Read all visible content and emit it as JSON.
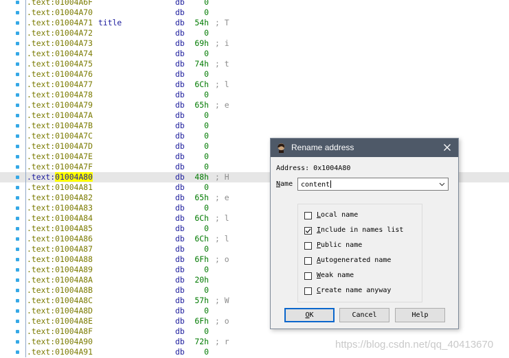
{
  "listing": {
    "rows": [
      {
        "seg": ".text:",
        "addr": "01004A6F",
        "label": "",
        "mnem": "db",
        "op": "0",
        "cmt": ""
      },
      {
        "seg": ".text:",
        "addr": "01004A70",
        "label": "",
        "mnem": "db",
        "op": "0",
        "cmt": ""
      },
      {
        "seg": ".text:",
        "addr": "01004A71",
        "label": "title",
        "mnem": "db",
        "op": "54h",
        "cmt": "; T"
      },
      {
        "seg": ".text:",
        "addr": "01004A72",
        "label": "",
        "mnem": "db",
        "op": "0",
        "cmt": ""
      },
      {
        "seg": ".text:",
        "addr": "01004A73",
        "label": "",
        "mnem": "db",
        "op": "69h",
        "cmt": "; i"
      },
      {
        "seg": ".text:",
        "addr": "01004A74",
        "label": "",
        "mnem": "db",
        "op": "0",
        "cmt": ""
      },
      {
        "seg": ".text:",
        "addr": "01004A75",
        "label": "",
        "mnem": "db",
        "op": "74h",
        "cmt": "; t"
      },
      {
        "seg": ".text:",
        "addr": "01004A76",
        "label": "",
        "mnem": "db",
        "op": "0",
        "cmt": ""
      },
      {
        "seg": ".text:",
        "addr": "01004A77",
        "label": "",
        "mnem": "db",
        "op": "6Ch",
        "cmt": "; l"
      },
      {
        "seg": ".text:",
        "addr": "01004A78",
        "label": "",
        "mnem": "db",
        "op": "0",
        "cmt": ""
      },
      {
        "seg": ".text:",
        "addr": "01004A79",
        "label": "",
        "mnem": "db",
        "op": "65h",
        "cmt": "; e"
      },
      {
        "seg": ".text:",
        "addr": "01004A7A",
        "label": "",
        "mnem": "db",
        "op": "0",
        "cmt": ""
      },
      {
        "seg": ".text:",
        "addr": "01004A7B",
        "label": "",
        "mnem": "db",
        "op": "0",
        "cmt": ""
      },
      {
        "seg": ".text:",
        "addr": "01004A7C",
        "label": "",
        "mnem": "db",
        "op": "0",
        "cmt": ""
      },
      {
        "seg": ".text:",
        "addr": "01004A7D",
        "label": "",
        "mnem": "db",
        "op": "0",
        "cmt": ""
      },
      {
        "seg": ".text:",
        "addr": "01004A7E",
        "label": "",
        "mnem": "db",
        "op": "0",
        "cmt": ""
      },
      {
        "seg": ".text:",
        "addr": "01004A7F",
        "label": "",
        "mnem": "db",
        "op": "0",
        "cmt": ""
      },
      {
        "seg": ".text:",
        "addr": "01004A80",
        "label": "",
        "mnem": "db",
        "op": "48h",
        "cmt": "; H",
        "selected": true
      },
      {
        "seg": ".text:",
        "addr": "01004A81",
        "label": "",
        "mnem": "db",
        "op": "0",
        "cmt": ""
      },
      {
        "seg": ".text:",
        "addr": "01004A82",
        "label": "",
        "mnem": "db",
        "op": "65h",
        "cmt": "; e"
      },
      {
        "seg": ".text:",
        "addr": "01004A83",
        "label": "",
        "mnem": "db",
        "op": "0",
        "cmt": ""
      },
      {
        "seg": ".text:",
        "addr": "01004A84",
        "label": "",
        "mnem": "db",
        "op": "6Ch",
        "cmt": "; l"
      },
      {
        "seg": ".text:",
        "addr": "01004A85",
        "label": "",
        "mnem": "db",
        "op": "0",
        "cmt": ""
      },
      {
        "seg": ".text:",
        "addr": "01004A86",
        "label": "",
        "mnem": "db",
        "op": "6Ch",
        "cmt": "; l"
      },
      {
        "seg": ".text:",
        "addr": "01004A87",
        "label": "",
        "mnem": "db",
        "op": "0",
        "cmt": ""
      },
      {
        "seg": ".text:",
        "addr": "01004A88",
        "label": "",
        "mnem": "db",
        "op": "6Fh",
        "cmt": "; o"
      },
      {
        "seg": ".text:",
        "addr": "01004A89",
        "label": "",
        "mnem": "db",
        "op": "0",
        "cmt": ""
      },
      {
        "seg": ".text:",
        "addr": "01004A8A",
        "label": "",
        "mnem": "db",
        "op": "20h",
        "cmt": ""
      },
      {
        "seg": ".text:",
        "addr": "01004A8B",
        "label": "",
        "mnem": "db",
        "op": "0",
        "cmt": ""
      },
      {
        "seg": ".text:",
        "addr": "01004A8C",
        "label": "",
        "mnem": "db",
        "op": "57h",
        "cmt": "; W"
      },
      {
        "seg": ".text:",
        "addr": "01004A8D",
        "label": "",
        "mnem": "db",
        "op": "0",
        "cmt": ""
      },
      {
        "seg": ".text:",
        "addr": "01004A8E",
        "label": "",
        "mnem": "db",
        "op": "6Fh",
        "cmt": "; o"
      },
      {
        "seg": ".text:",
        "addr": "01004A8F",
        "label": "",
        "mnem": "db",
        "op": "0",
        "cmt": ""
      },
      {
        "seg": ".text:",
        "addr": "01004A90",
        "label": "",
        "mnem": "db",
        "op": "72h",
        "cmt": "; r"
      },
      {
        "seg": ".text:",
        "addr": "01004A91",
        "label": "",
        "mnem": "db",
        "op": "0",
        "cmt": ""
      }
    ]
  },
  "dialog": {
    "title": "Rename address",
    "address_label": "Address: 0x1004A80",
    "name_label_first": "N",
    "name_label_rest": "ame",
    "name_value": "content",
    "options": [
      {
        "first": "L",
        "rest": "ocal name",
        "checked": false
      },
      {
        "first": "I",
        "rest": "nclude in names list",
        "checked": true
      },
      {
        "first": "P",
        "rest": "ublic name",
        "checked": false
      },
      {
        "first": "A",
        "rest": "utogenerated name",
        "checked": false
      },
      {
        "first": "W",
        "rest": "eak name",
        "checked": false
      },
      {
        "first": "C",
        "rest": "reate name anyway",
        "checked": false
      }
    ],
    "buttons": {
      "ok_first": "O",
      "ok_rest": "K",
      "cancel": "Cancel",
      "help": "Help"
    }
  },
  "watermark": "https://blog.csdn.net/qq_40413670",
  "colors": {
    "title_bar": "#4e5968",
    "address_highlight": "#ffff00",
    "default_button_border": "#0a66cc"
  },
  "icons": [
    "app-icon",
    "close-icon",
    "chevron-down-icon",
    "check-icon"
  ]
}
